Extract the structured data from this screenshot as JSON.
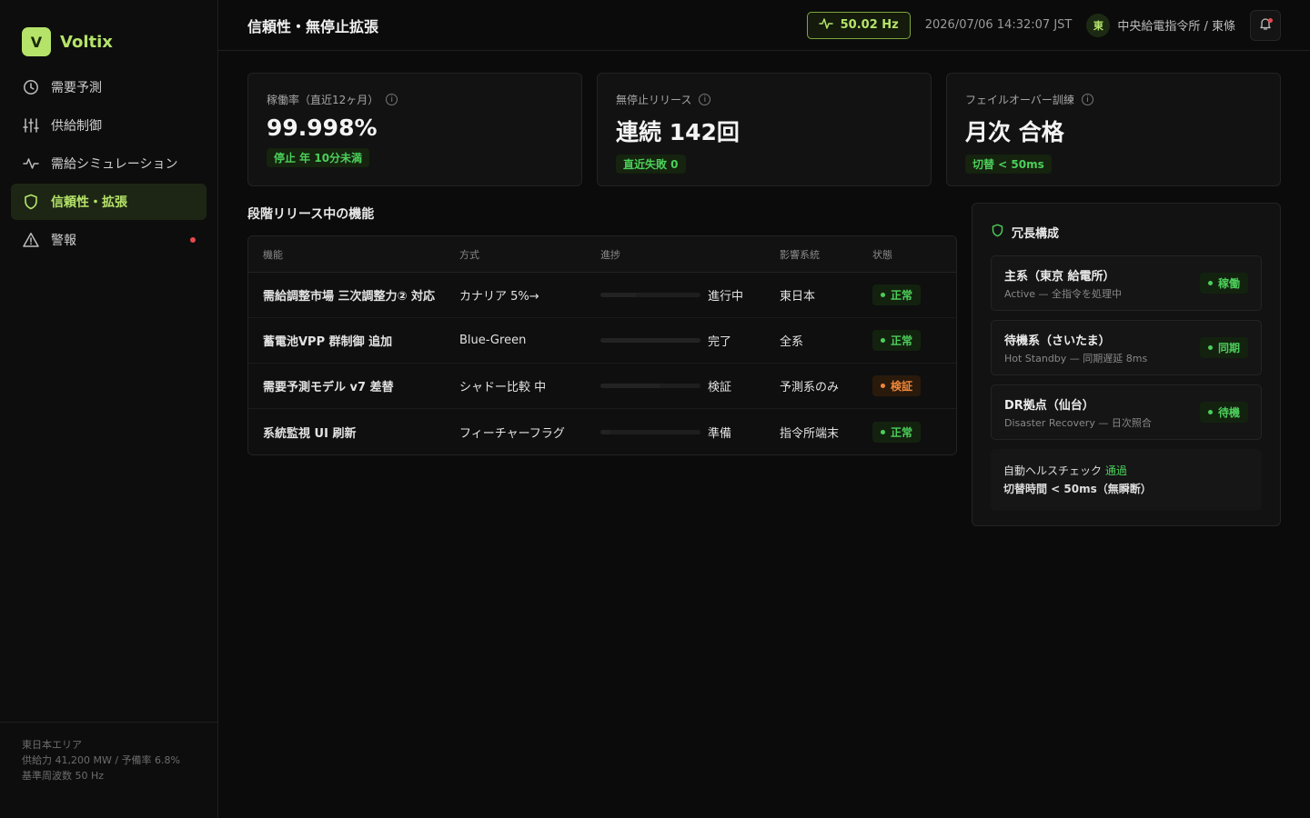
{
  "brand": {
    "logo_letter": "V",
    "name": "Voltix"
  },
  "sidebar": {
    "items": [
      {
        "label": "需要予測",
        "icon": "clock-icon"
      },
      {
        "label": "供給制御",
        "icon": "sliders-icon"
      },
      {
        "label": "需給シミュレーション",
        "icon": "pulse-icon"
      },
      {
        "label": "信頼性・拡張",
        "icon": "shield-icon",
        "active": true
      },
      {
        "label": "警報",
        "icon": "warning-icon",
        "has_alert_dot": true
      }
    ],
    "footer": {
      "area": "東日本エリア",
      "supply": "供給力 41,200 MW / 予備率 6.8%",
      "frequency": "基準周波数 50 Hz"
    }
  },
  "header": {
    "title": "信頼性・無停止拡張",
    "frequency": "50.02 Hz",
    "timestamp": "2026/07/06 14:32:07 JST",
    "site_avatar": "東",
    "site_name": "中央給電指令所 / 東條"
  },
  "kpis": [
    {
      "label": "稼働率（直近12ヶ月）",
      "value": "99.998%",
      "badge": "停止 年 10分未満"
    },
    {
      "label": "無停止リリース",
      "value": "連続 142回",
      "badge": "直近失敗 0"
    },
    {
      "label": "フェイルオーバー訓練",
      "value": "月次 合格",
      "badge": "切替 < 50ms"
    }
  ],
  "releases": {
    "title": "段階リリース中の機能",
    "columns": [
      "機能",
      "方式",
      "進捗",
      "影響系統",
      "状態"
    ],
    "rows": [
      {
        "feature": "需給調整市場 三次調整力② 対応",
        "method": "カナリア 5%→",
        "progress_label": "進行中",
        "progress": 0.35,
        "scope": "東日本",
        "status": "正常",
        "status_type": "ok"
      },
      {
        "feature": "蓄電池VPP 群制御 追加",
        "method": "Blue-Green",
        "progress_label": "完了",
        "progress": 1.0,
        "scope": "全系",
        "status": "正常",
        "status_type": "ok"
      },
      {
        "feature": "需要予測モデル v7 差替",
        "method": "シャドー比較 中",
        "progress_label": "検証",
        "progress": 0.6,
        "scope": "予測系のみ",
        "status": "検証",
        "status_type": "warn"
      },
      {
        "feature": "系統監視 UI 刷新",
        "method": "フィーチャーフラグ",
        "progress_label": "準備",
        "progress": 0.1,
        "scope": "指令所端末",
        "status": "正常",
        "status_type": "ok"
      }
    ]
  },
  "redundancy": {
    "title": "冗長構成",
    "nodes": [
      {
        "name": "主系（東京 給電所）",
        "sub": "Active — 全指令を処理中",
        "status": "稼働"
      },
      {
        "name": "待機系（さいたま）",
        "sub": "Hot Standby — 同期遅延 8ms",
        "status": "同期"
      },
      {
        "name": "DR拠点（仙台）",
        "sub": "Disaster Recovery — 日次照合",
        "status": "待機"
      }
    ],
    "health_prefix": "自動ヘルスチェック",
    "health_status": "通過",
    "switch_time": "切替時間 < 50ms（無瞬断）"
  },
  "colors": {
    "accent": "#b5e36a",
    "ok": "#4ccf5a",
    "warn": "#f0873a",
    "alert": "#e5484d"
  }
}
